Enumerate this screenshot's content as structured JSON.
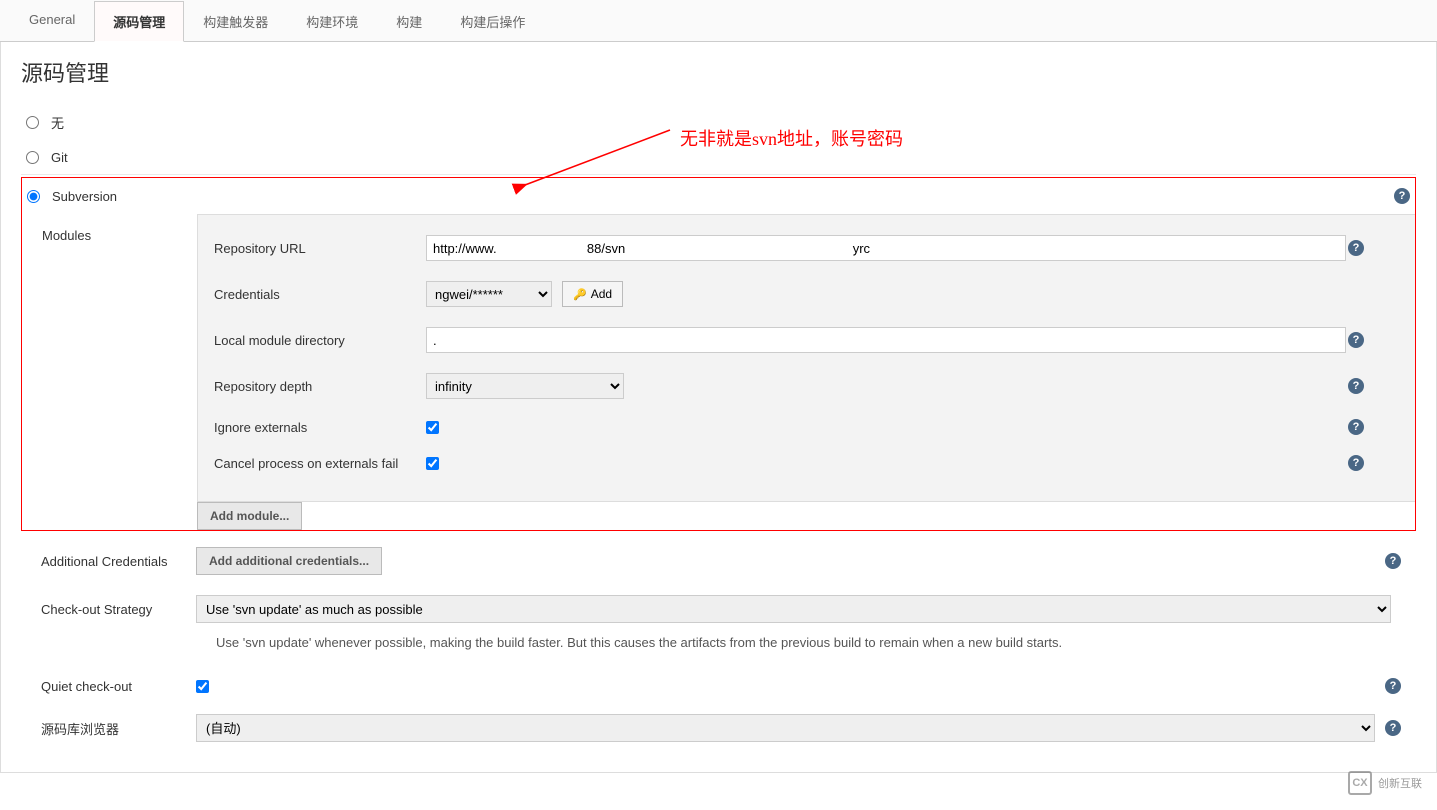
{
  "tabs": {
    "items": [
      {
        "label": "General"
      },
      {
        "label": "源码管理"
      },
      {
        "label": "构建触发器"
      },
      {
        "label": "构建环境"
      },
      {
        "label": "构建"
      },
      {
        "label": "构建后操作"
      }
    ],
    "activeIndex": 1
  },
  "section": {
    "title": "源码管理"
  },
  "scm": {
    "none_label": "无",
    "git_label": "Git",
    "subversion_label": "Subversion"
  },
  "annotation": "无非就是svn地址，账号密码",
  "modules": {
    "section_label": "Modules",
    "repo_url_label": "Repository URL",
    "repo_url_value": "http://www.                         88/svn                                                               yrc",
    "credentials_label": "Credentials",
    "credentials_value": "ngwei/******",
    "add_cred_label": "Add",
    "local_dir_label": "Local module directory",
    "local_dir_value": ".",
    "depth_label": "Repository depth",
    "depth_value": "infinity",
    "ignore_externals_label": "Ignore externals",
    "cancel_on_fail_label": "Cancel process on externals fail",
    "add_module_label": "Add module..."
  },
  "additional": {
    "label": "Additional Credentials",
    "button_label": "Add additional credentials..."
  },
  "checkout": {
    "label": "Check-out Strategy",
    "value": "Use 'svn update' as much as possible",
    "description": "Use 'svn update' whenever possible, making the build faster. But this causes the artifacts from the previous build to remain when a new build starts."
  },
  "quiet": {
    "label": "Quiet check-out"
  },
  "browser": {
    "label": "源码库浏览器",
    "value": "(自动)"
  },
  "watermark": {
    "text": "创新互联"
  }
}
